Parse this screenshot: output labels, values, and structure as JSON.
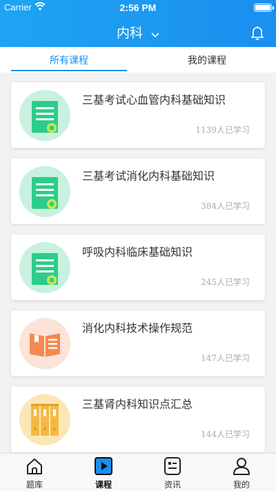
{
  "status": {
    "carrier": "Carrier",
    "time": "2:56 PM"
  },
  "nav": {
    "title": "内科"
  },
  "tabs": [
    {
      "label": "所有课程"
    },
    {
      "label": "我的课程"
    }
  ],
  "courses": [
    {
      "title": "三基考试心血管内科基础知识",
      "count": "1139人已学习",
      "icon": "document-certificate-icon"
    },
    {
      "title": "三基考试消化内科基础知识",
      "count": "384人已学习",
      "icon": "document-certificate-icon"
    },
    {
      "title": "呼吸内科临床基础知识",
      "count": "245人已学习",
      "icon": "document-certificate-icon"
    },
    {
      "title": "消化内科技术操作规范",
      "count": "147人已学习",
      "icon": "open-book-icon"
    },
    {
      "title": "三基肾内科知识点汇总",
      "count": "144人已学习",
      "icon": "binders-icon"
    }
  ],
  "tabbar": [
    {
      "label": "题库",
      "icon": "home-icon"
    },
    {
      "label": "课程",
      "icon": "play-icon"
    },
    {
      "label": "资讯",
      "icon": "news-icon"
    },
    {
      "label": "我的",
      "icon": "user-icon"
    }
  ],
  "colors": {
    "primary": "#1a8ff0",
    "doc_green": "#2ecc8a",
    "book_orange": "#f5894f",
    "binder_yellow": "#f4b942"
  }
}
